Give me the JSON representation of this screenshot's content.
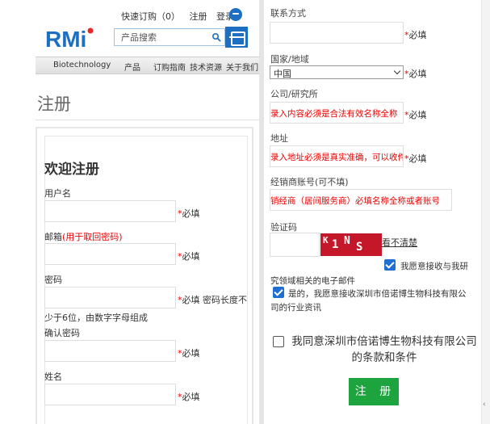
{
  "header": {
    "quick_order": "快速订购（0）",
    "register": "注册",
    "login": "登录",
    "logo_text": "RMi",
    "search_placeholder": "产品搜索",
    "brand_color": "#1c6fc2"
  },
  "nav": {
    "items": [
      "Biotechnology",
      "产品",
      "订购指南",
      "技术资源",
      "关于我们"
    ]
  },
  "page": {
    "title": "注册",
    "welcome": "欢迎注册"
  },
  "left_form": {
    "username_label": "用户名",
    "email_label": "邮箱",
    "email_hint": "(用于取回密码)",
    "password_label": "密码",
    "password_hint": "密码长度不少于6位，由数字字母组成",
    "password_hint_a": "密码长度不",
    "password_hint_b": "少于6位，由数字字母组成",
    "confirm_label": "确认密码",
    "name_label": "姓名",
    "required_star": "*",
    "required_text": "必填"
  },
  "right_form": {
    "contact_label": "联系方式",
    "country_label": "国家/地域",
    "country_value": "中国",
    "company_label": "公司/研究所",
    "company_hint": "录入内容必须是合法有效名称全称",
    "address_label": "地址",
    "address_hint": "录入地址必须是真实准确，可以收件",
    "dealer_label": "经销商账号(可不填)",
    "dealer_hint": "销经商（居间服务商）必填名称全称或者账号",
    "captcha_label": "验证码",
    "captcha_chars": [
      "K",
      "1",
      "N",
      "S"
    ],
    "captcha_refresh": "看不清楚",
    "consent_research": "我愿意接收与我研究领域相关的电子邮件",
    "consent_research_a": "我愿意接收与我研",
    "consent_research_b": "究领域相关的电子邮件",
    "consent_industry": "是的，我愿意接收深圳市倍诺博生物科技有限公司的行业资讯",
    "consent_industry_a": "是的，我愿意接收深圳市倍诺博生物科技有限公",
    "consent_industry_b": "司的行业资讯",
    "agree_a": "我同意深圳市倍诺博生物科技有限公司",
    "agree_b": "的条款和条件",
    "submit": "注 册",
    "consent_research_checked": true,
    "consent_industry_checked": true,
    "agree_checked": false
  }
}
